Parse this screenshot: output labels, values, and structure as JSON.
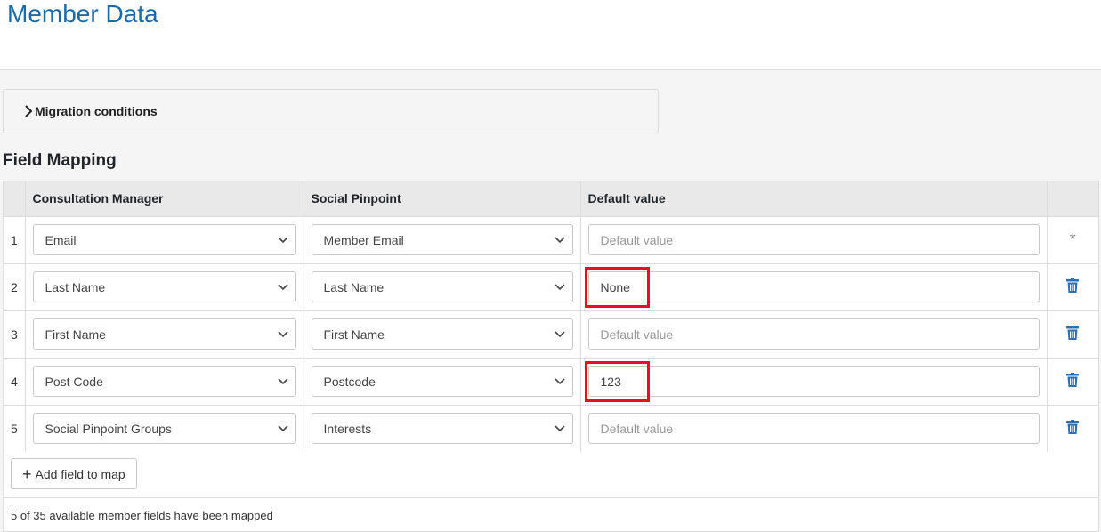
{
  "page": {
    "title": "Member Data"
  },
  "migration": {
    "label": "Migration conditions"
  },
  "field_mapping": {
    "title": "Field Mapping",
    "columns": [
      "Consultation Manager",
      "Social Pinpoint",
      "Default value"
    ],
    "rows": [
      {
        "num": "1",
        "cm": "Email",
        "sp": "Member Email",
        "default": "",
        "placeholder": "Default value",
        "action": "asterisk"
      },
      {
        "num": "2",
        "cm": "Last Name",
        "sp": "Last Name",
        "default": "None",
        "placeholder": "Default value",
        "action": "trash"
      },
      {
        "num": "3",
        "cm": "First Name",
        "sp": "First Name",
        "default": "",
        "placeholder": "Default value",
        "action": "trash"
      },
      {
        "num": "4",
        "cm": "Post Code",
        "sp": "Postcode",
        "default": "123",
        "placeholder": "Default value",
        "action": "trash"
      },
      {
        "num": "5",
        "cm": "Social Pinpoint Groups",
        "sp": "Interests",
        "default": "",
        "placeholder": "Default value",
        "action": "trash"
      }
    ],
    "add_button": "Add field to map",
    "status": "5 of 35 available member fields have been mapped",
    "asterisk_symbol": "*"
  },
  "colors": {
    "title": "#1a6aa7",
    "trash": "#2d6fb3",
    "highlight": "#e1131e"
  }
}
